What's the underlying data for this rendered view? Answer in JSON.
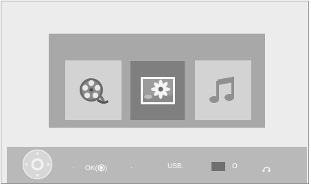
{
  "menu": {
    "items": [
      {
        "name": "video",
        "icon": "film-reel-icon"
      },
      {
        "name": "photo",
        "icon": "photo-flower-icon",
        "selected": true
      },
      {
        "name": "music",
        "icon": "music-note-icon"
      }
    ]
  },
  "hint_bar": {
    "navigate_icon": "dpad-icon",
    "dot_left": ".",
    "ok_label": "OK(",
    "ok_close": ")",
    "ok_icon": "ok-circle-icon",
    "dot_mid": ".",
    "usb_label": "USB.",
    "input_icon": "input-source-icon",
    "input_label": "O",
    "return_icon": "return-icon"
  },
  "colors": {
    "screen_bg": "#ececec",
    "panel_bg": "#a8a8a8",
    "tile_bg": "#d3d3d3",
    "tile_selected_bg": "#7f7f7f",
    "bar_bg": "#b9b9b9"
  }
}
